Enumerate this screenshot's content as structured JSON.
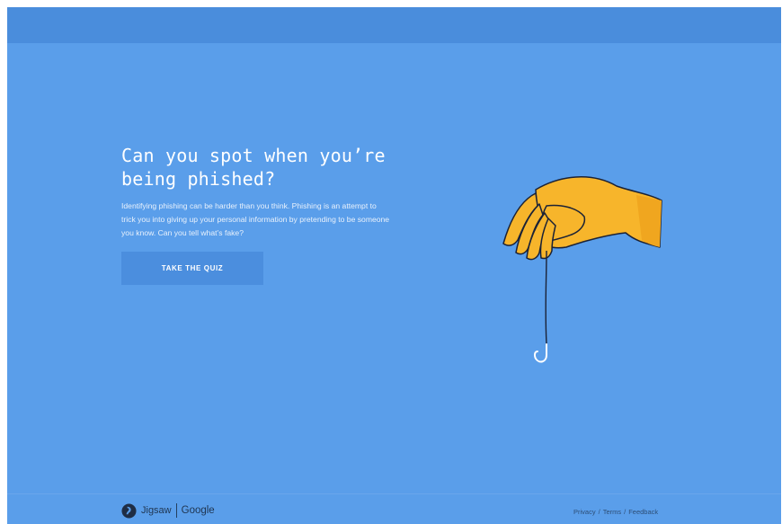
{
  "hero": {
    "title": "Can you spot when you’re being phished?",
    "description": "Identifying phishing can be harder than you think. Phishing is an attempt to trick you into giving up your personal information by pretending to be someone you know. Can you tell what’s fake?",
    "cta_label": "TAKE THE QUIZ"
  },
  "illustration": {
    "icon": "hand-holding-hook-icon"
  },
  "footer": {
    "brand_jigsaw": "Jigsaw",
    "brand_google": "Google",
    "links": {
      "privacy": "Privacy",
      "terms": "Terms",
      "feedback": "Feedback",
      "separator": "/"
    }
  },
  "colors": {
    "background": "#5a9eea",
    "topbar": "#4a8ddc",
    "button": "#4b8ede",
    "hand": "#f7b52b",
    "outline": "#1b2236"
  }
}
